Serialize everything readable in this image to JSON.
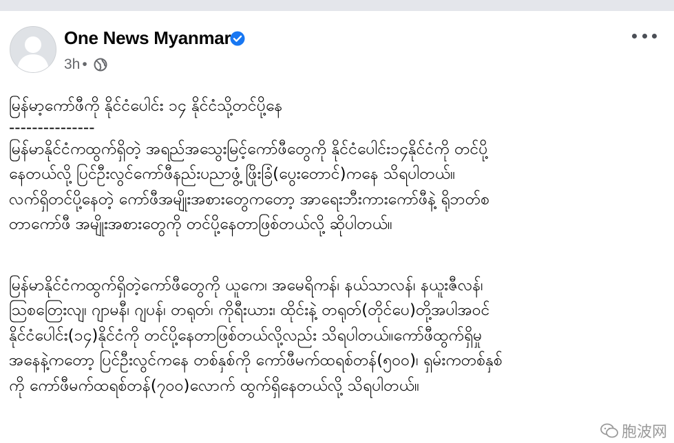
{
  "post": {
    "author": "One News Myanmar",
    "time": "3h",
    "dot": "•",
    "title": "မြန်မာ့ကော်ဖီကို နိုင်ငံပေါင်း ၁၄ နိုင်ငံသို့တင်ပို့နေ",
    "separator": "---------------",
    "para1": [
      "မြန်မာနိုင်ငံကထွက်ရှိတဲ့ အရည်အသွေးမြင့်ကော်ဖီတွေကို နိုင်ငံပေါင်း၁၄နိုင်ငံကို တင်ပို့",
      "နေတယ်လို့ ပြင်ဦးလွင်ကော်ဖီနည်းပညာဖွံ့ ဖြိုးခြံ(ပွေးတောင်)ကနေ သိရပါတယ်။",
      "လက်ရှိတင်ပို့နေတဲ့ ကော်ဖီအမျိုးအစားတွေကတော့ အာရေးဘီးကားကော်ဖီနဲ့ ရိုဘတ်စ",
      "တာကော်ဖီ အမျိုးအစားတွေကို တင်ပို့နေတာဖြစ်တယ်လို့ ဆိုပါတယ်။"
    ],
    "para2": [
      "မြန်မာနိုင်ငံကထွက်ရှိတဲ့ကော်ဖီတွေကို ယူကေ၊ အမေရိကန်၊ နယ်သာလန်၊ နယူးဇီလန်၊",
      "သြစတြေးလျ၊ ဂျာမနီ၊ ဂျပန်၊ တရုတ်၊ ကိုရီးယား၊ ထိုင်းနဲ့ တရုတ်(တိုင်ပေ)တို့အပါအဝင်",
      "နိုင်ငံပေါင်း(၁၄)နိုင်ငံကို တင်ပို့နေတာဖြစ်တယ်လို့လည်း သိရပါတယ်။ကော်ဖီထွက်ရှိမှု",
      "အနေနဲ့ကတော့ ပြင်ဦးလွင်ကနေ တစ်နှစ်ကို ကော်ဖီမက်ထရစ်တန်(၅၀၀)၊ ရှမ်းကတစ်နှစ်",
      "ကို ကော်ဖီမက်ထရစ်တန်(၇၀၀)လောက် ထွက်ရှိနေတယ်လို့ သိရပါတယ်။"
    ]
  },
  "watermark": {
    "text": "胞波网"
  },
  "icons": {
    "verified": "verified-badge-icon",
    "privacy": "globe-icon",
    "menu": "more-options-icon"
  },
  "colors": {
    "verified": "#1877f2",
    "meta": "#65676b",
    "topbar": "#e4e6eb"
  }
}
